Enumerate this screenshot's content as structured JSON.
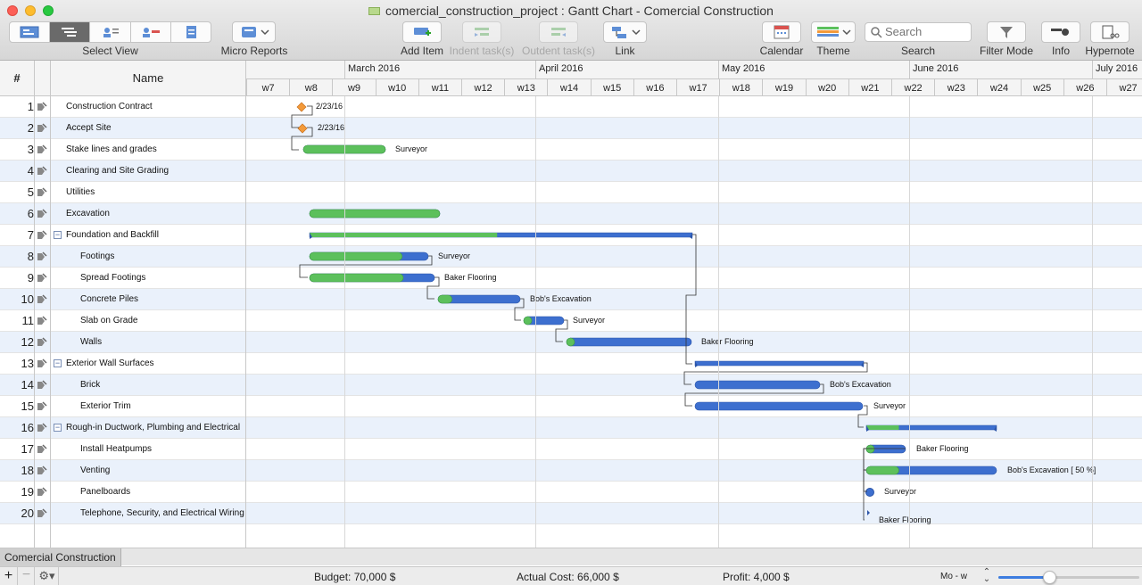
{
  "window": {
    "title": "comercial_construction_project : Gantt Chart - Comercial Construction"
  },
  "toolbar": {
    "select_view": "Select View",
    "micro_reports": "Micro Reports",
    "add_item": "Add Item",
    "indent": "Indent task(s)",
    "outdent": "Outdent task(s)",
    "link": "Link",
    "calendar": "Calendar",
    "theme": "Theme",
    "search_placeholder": "Search",
    "search": "Search",
    "filter_mode": "Filter Mode",
    "info": "Info",
    "hypernote": "Hypernote"
  },
  "table": {
    "num_header": "#",
    "name_header": "Name"
  },
  "timeline": {
    "months": [
      "March 2016",
      "April 2016",
      "May 2016",
      "June 2016",
      "July 2016"
    ],
    "weeks": [
      "w7",
      "w8",
      "w9",
      "w10",
      "w11",
      "w12",
      "w13",
      "w14",
      "w15",
      "w16",
      "w17",
      "w18",
      "w19",
      "w20",
      "w21",
      "w22",
      "w23",
      "w24",
      "w25",
      "w26",
      "w27"
    ]
  },
  "tasks": [
    {
      "n": "1",
      "name": "Construction Contract",
      "level": 0,
      "kind": "milestone",
      "label": "2/23/16"
    },
    {
      "n": "2",
      "name": "Accept Site",
      "level": 0,
      "kind": "milestone",
      "label": "2/23/16"
    },
    {
      "n": "3",
      "name": "Stake lines and grades",
      "level": 0,
      "kind": "task",
      "label": "Surveyor"
    },
    {
      "n": "4",
      "name": "Clearing and Site Grading",
      "level": 0,
      "kind": "none",
      "label": ""
    },
    {
      "n": "5",
      "name": "Utilities",
      "level": 0,
      "kind": "none",
      "label": ""
    },
    {
      "n": "6",
      "name": "Excavation",
      "level": 0,
      "kind": "task",
      "label": ""
    },
    {
      "n": "7",
      "name": "Foundation and Backfill",
      "level": 0,
      "kind": "summary",
      "label": ""
    },
    {
      "n": "8",
      "name": "Footings",
      "level": 1,
      "kind": "task",
      "label": "Surveyor"
    },
    {
      "n": "9",
      "name": "Spread Footings",
      "level": 1,
      "kind": "task",
      "label": "Baker Flooring"
    },
    {
      "n": "10",
      "name": "Concrete Piles",
      "level": 1,
      "kind": "task",
      "label": "Bob's Excavation"
    },
    {
      "n": "11",
      "name": "Slab on Grade",
      "level": 1,
      "kind": "task",
      "label": "Surveyor"
    },
    {
      "n": "12",
      "name": "Walls",
      "level": 1,
      "kind": "task",
      "label": "Baker Flooring"
    },
    {
      "n": "13",
      "name": "Exterior Wall Surfaces",
      "level": 0,
      "kind": "summary",
      "label": ""
    },
    {
      "n": "14",
      "name": "Brick",
      "level": 1,
      "kind": "task",
      "label": "Bob's Excavation"
    },
    {
      "n": "15",
      "name": "Exterior Trim",
      "level": 1,
      "kind": "task",
      "label": "Surveyor"
    },
    {
      "n": "16",
      "name": "Rough-in Ductwork, Plumbing and Electrical",
      "level": 0,
      "kind": "summary",
      "label": ""
    },
    {
      "n": "17",
      "name": "Install Heatpumps",
      "level": 1,
      "kind": "task",
      "label": "Baker Flooring"
    },
    {
      "n": "18",
      "name": "Venting",
      "level": 1,
      "kind": "task",
      "label": "Bob's Excavation [ 50 %]"
    },
    {
      "n": "19",
      "name": "Panelboards",
      "level": 1,
      "kind": "task",
      "label": "Surveyor"
    },
    {
      "n": "20",
      "name": "Telephone, Security, and Electrical Wiring",
      "level": 1,
      "kind": "task",
      "label": "Baker Flooring"
    }
  ],
  "bottom": {
    "sheet_tab": "Comercial Construction",
    "budget": "Budget: 70,000 $",
    "actual_cost": "Actual Cost: 66,000 $",
    "profit": "Profit: 4,000 $",
    "zoom_unit": "Mo - w"
  },
  "colors": {
    "done": "#5cc05c",
    "remaining": "#3d6fcf",
    "milestone": "#f39a3a",
    "row_alt": "#eaf1fb"
  }
}
